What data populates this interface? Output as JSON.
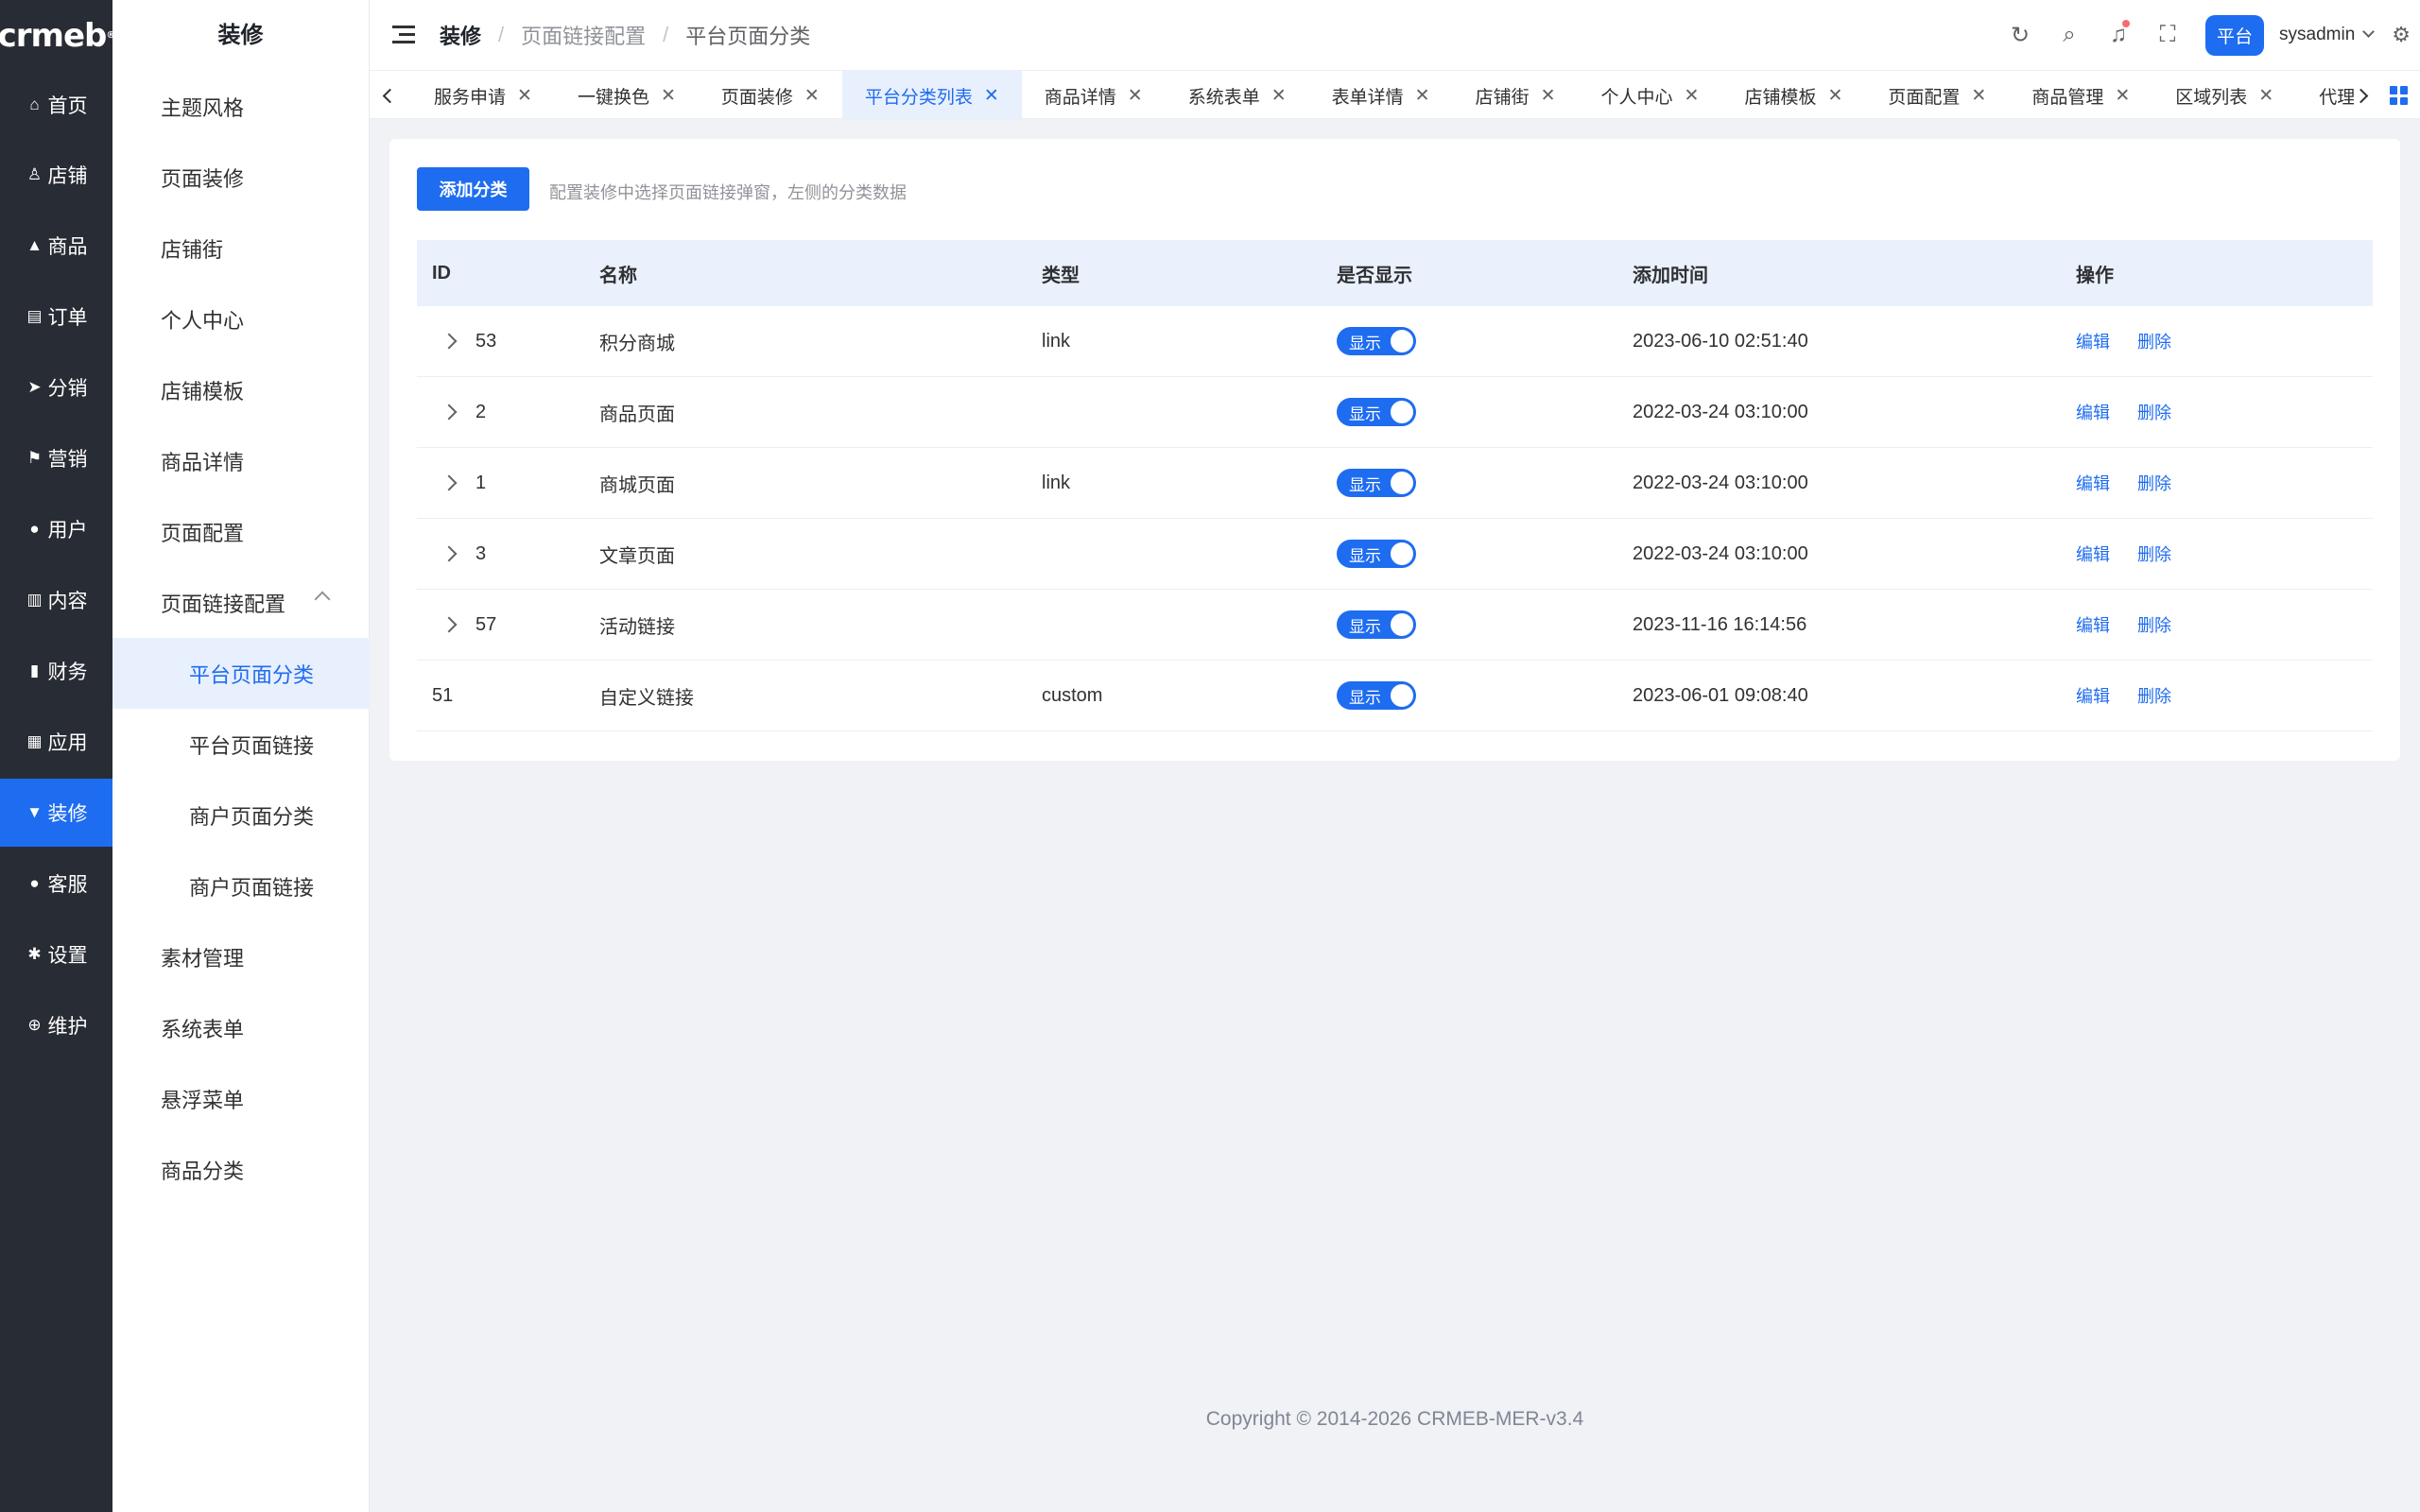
{
  "logo": "crmeb",
  "rail": [
    {
      "label": "首页",
      "icon": "home-icon",
      "glyph": "⌂"
    },
    {
      "label": "店铺",
      "icon": "store-icon",
      "glyph": "♙"
    },
    {
      "label": "商品",
      "icon": "bag-icon",
      "glyph": "▲"
    },
    {
      "label": "订单",
      "icon": "order-icon",
      "glyph": "▤"
    },
    {
      "label": "分销",
      "icon": "send-icon",
      "glyph": "➤"
    },
    {
      "label": "营销",
      "icon": "flag-icon",
      "glyph": "⚑"
    },
    {
      "label": "用户",
      "icon": "user-icon",
      "glyph": "●"
    },
    {
      "label": "内容",
      "icon": "book-icon",
      "glyph": "▥"
    },
    {
      "label": "财务",
      "icon": "chart-icon",
      "glyph": "▮"
    },
    {
      "label": "应用",
      "icon": "grid-icon",
      "glyph": "▦"
    },
    {
      "label": "装修",
      "icon": "brush-icon",
      "glyph": "▼"
    },
    {
      "label": "客服",
      "icon": "service-icon",
      "glyph": "●"
    },
    {
      "label": "设置",
      "icon": "gear-icon",
      "glyph": "✱"
    },
    {
      "label": "维护",
      "icon": "maintain-icon",
      "glyph": "⊕"
    }
  ],
  "submenu": {
    "title": "装修",
    "items": [
      {
        "label": "主题风格"
      },
      {
        "label": "页面装修"
      },
      {
        "label": "店铺街"
      },
      {
        "label": "个人中心"
      },
      {
        "label": "店铺模板"
      },
      {
        "label": "商品详情"
      },
      {
        "label": "页面配置"
      },
      {
        "label": "页面链接配置"
      },
      {
        "label": "平台页面分类"
      },
      {
        "label": "平台页面链接"
      },
      {
        "label": "商户页面分类"
      },
      {
        "label": "商户页面链接"
      },
      {
        "label": "素材管理"
      },
      {
        "label": "系统表单"
      },
      {
        "label": "悬浮菜单"
      },
      {
        "label": "商品分类"
      }
    ]
  },
  "header": {
    "breadcrumb": [
      "装修",
      "页面链接配置",
      "平台页面分类"
    ],
    "platform": "平台",
    "user": "sysadmin"
  },
  "tags": [
    "服务申请",
    "一键换色",
    "页面装修",
    "平台分类列表",
    "商品详情",
    "系统表单",
    "表单详情",
    "店铺街",
    "个人中心",
    "店铺模板",
    "页面配置",
    "商品管理",
    "区域列表",
    "代理"
  ],
  "main": {
    "add_button": "添加分类",
    "hint": "配置装修中选择页面链接弹窗，左侧的分类数据",
    "columns": [
      "ID",
      "名称",
      "类型",
      "是否显示",
      "添加时间",
      "操作"
    ],
    "rows": [
      {
        "id": "53",
        "name": "积分商城",
        "type": "link",
        "show": "显示",
        "time": "2023-06-10 02:51:40"
      },
      {
        "id": "2",
        "name": "商品页面",
        "type": "",
        "show": "显示",
        "time": "2022-03-24 03:10:00"
      },
      {
        "id": "1",
        "name": "商城页面",
        "type": "link",
        "show": "显示",
        "time": "2022-03-24 03:10:00"
      },
      {
        "id": "3",
        "name": "文章页面",
        "type": "",
        "show": "显示",
        "time": "2022-03-24 03:10:00"
      },
      {
        "id": "57",
        "name": "活动链接",
        "type": "",
        "show": "显示",
        "time": "2023-11-16 16:14:56"
      },
      {
        "id": "51",
        "name": "自定义链接",
        "type": "custom",
        "show": "显示",
        "time": "2023-06-01 09:08:40"
      }
    ],
    "edit_label": "编辑",
    "delete_label": "删除"
  },
  "footer": "Copyright © 2014-2026 CRMEB-MER-v3.4",
  "colors": {
    "primary": "#1e6cf0",
    "rail_bg": "#282c34"
  }
}
